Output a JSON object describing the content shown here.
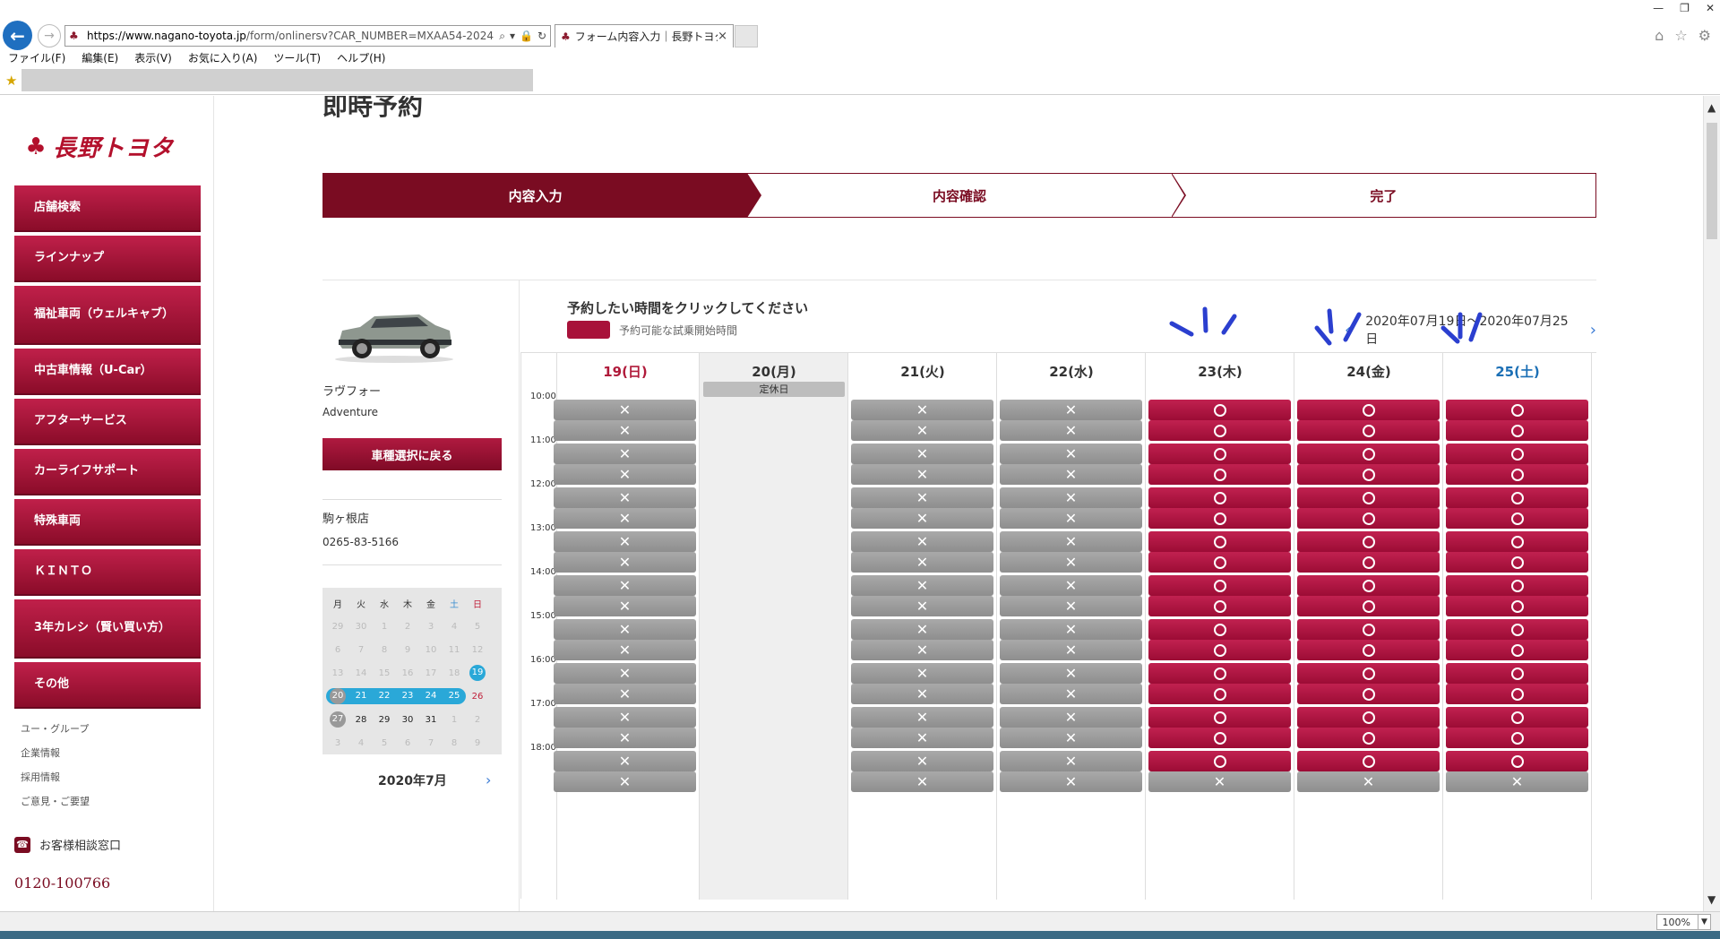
{
  "browser": {
    "url_domain": "https://www.nagano-toyota.jp",
    "url_rest": "/form/onlinersv?CAR_NUMBER=MXAA54-2024",
    "tab_title": "フォーム内容入力｜長野トヨタ",
    "tab_close": "×",
    "menu": [
      "ファイル(F)",
      "編集(E)",
      "表示(V)",
      "お気に入り(A)",
      "ツール(T)",
      "ヘルプ(H)"
    ],
    "zoom": "100%"
  },
  "sidebar": {
    "logo_text": "長野トヨタ",
    "items": [
      "店舗検索",
      "ラインナップ",
      "福祉車両（ウェルキャブ）",
      "中古車情報（U-Car）",
      "アフターサービス",
      "カーライフサポート",
      "特殊車両",
      "ＫＩＮＴＯ",
      "3年カレシ（賢い買い方）",
      "その他"
    ],
    "links": [
      "ユー・グループ",
      "企業情報",
      "採用情報",
      "ご意見・ご要望"
    ],
    "support_label": "お客様相談窓口",
    "phone": "0120-100766"
  },
  "page": {
    "title": "即時予約",
    "steps": [
      "内容入力",
      "内容確認",
      "完了"
    ],
    "active_step": 0
  },
  "info": {
    "car_name": "ラヴフォー",
    "car_grade": "Adventure",
    "back_button": "車種選択に戻る",
    "shop_name": "駒ヶ根店",
    "shop_tel": "0265-83-5166"
  },
  "mini_calendar": {
    "month_label": "2020年7月",
    "weekdays": [
      "月",
      "火",
      "水",
      "木",
      "金",
      "土",
      "日"
    ],
    "weeks": [
      [
        "29",
        "30",
        "1",
        "2",
        "3",
        "4",
        "5"
      ],
      [
        "6",
        "7",
        "8",
        "9",
        "10",
        "11",
        "12"
      ],
      [
        "13",
        "14",
        "15",
        "16",
        "17",
        "18",
        "19"
      ],
      [
        "20",
        "21",
        "22",
        "23",
        "24",
        "25",
        "26"
      ],
      [
        "27",
        "28",
        "29",
        "30",
        "31",
        "1",
        "2"
      ],
      [
        "3",
        "4",
        "5",
        "6",
        "7",
        "8",
        "9"
      ]
    ]
  },
  "schedule": {
    "instruction": "予約したい時間をクリックしてください",
    "legend_label": "予約可能な試乗開始時間",
    "range_label": "2020年07月19日～2020年07月25日",
    "closed_label": "定休日",
    "times": [
      "10:00",
      "11:00",
      "12:00",
      "13:00",
      "14:00",
      "15:00",
      "16:00",
      "17:00",
      "18:00"
    ],
    "days": [
      {
        "label": "19(日)",
        "kind": "sun",
        "closed": false,
        "slots": "xxxxxxxxxxxxxxxxxx"
      },
      {
        "label": "20(月)",
        "kind": "weekday",
        "closed": true,
        "slots": ""
      },
      {
        "label": "21(火)",
        "kind": "weekday",
        "closed": false,
        "slots": "xxxxxxxxxxxxxxxxxx"
      },
      {
        "label": "22(水)",
        "kind": "weekday",
        "closed": false,
        "slots": "xxxxxxxxxxxxxxxxxx"
      },
      {
        "label": "23(木)",
        "kind": "weekday",
        "closed": false,
        "slots": "ooooooooooooooooox"
      },
      {
        "label": "24(金)",
        "kind": "weekday",
        "closed": false,
        "slots": "ooooooooooooooooox"
      },
      {
        "label": "25(土)",
        "kind": "sat",
        "closed": false,
        "slots": "ooooooooooooooooox"
      }
    ]
  },
  "colors": {
    "brand": "#7a0c22",
    "available": "#a8123a",
    "unavailable": "#999999",
    "sun": "#b01a3a",
    "sat": "#1b6fb5",
    "annotation": "#2b3fcf"
  }
}
